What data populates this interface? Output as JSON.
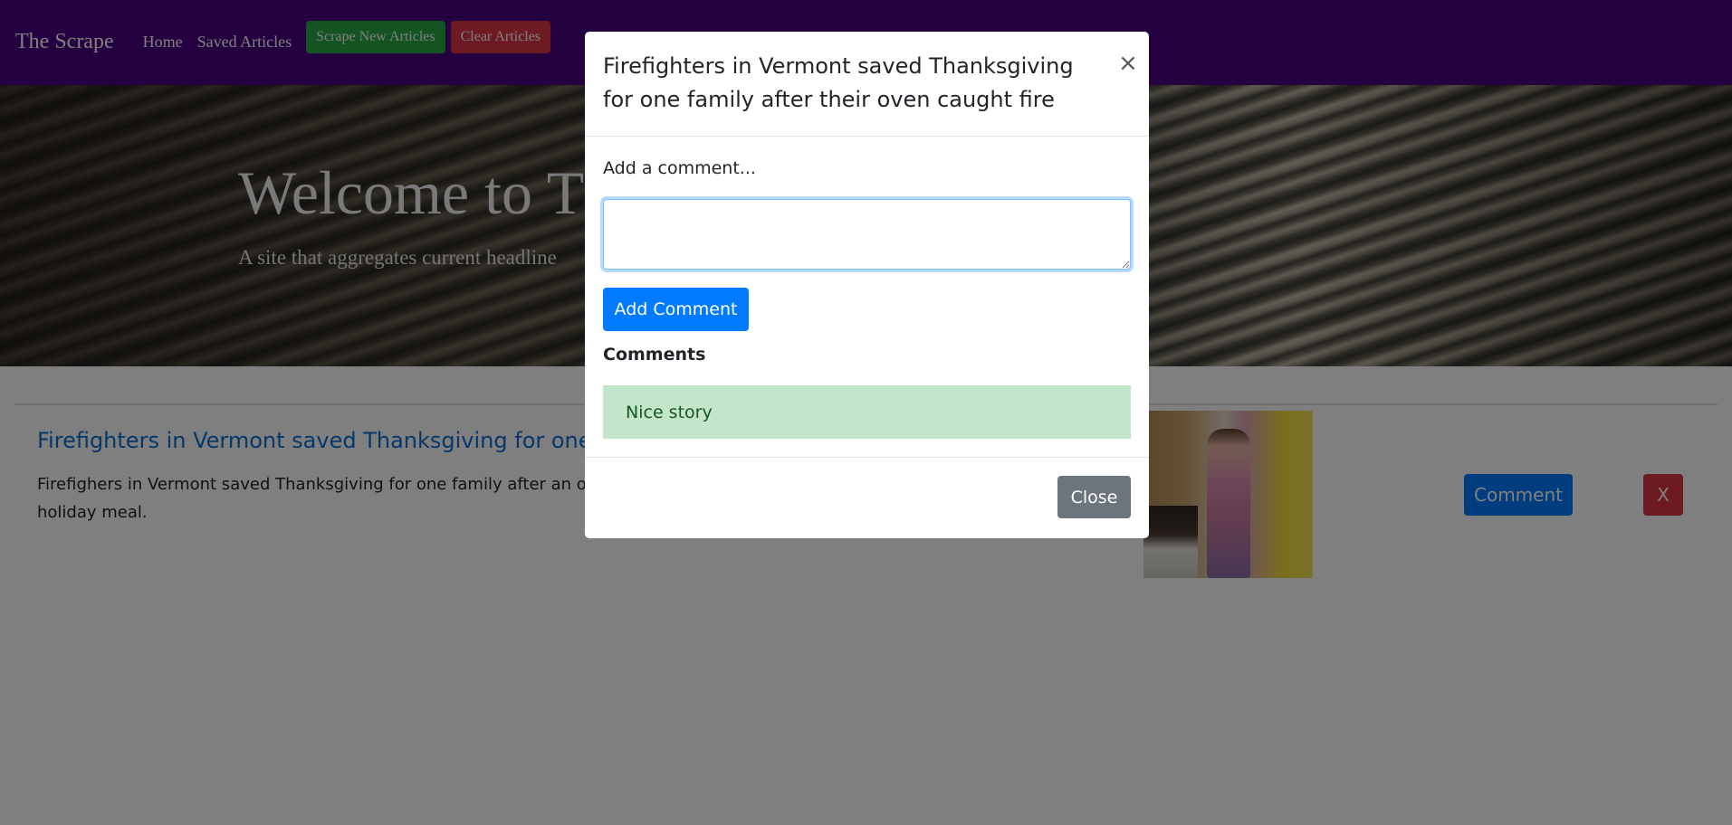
{
  "navbar": {
    "brand": "The Scrape",
    "links": [
      "Home",
      "Saved Articles"
    ],
    "scrape_button": "Scrape New Articles",
    "clear_button": "Clear Articles"
  },
  "hero": {
    "title": "Welcome to T",
    "subtitle": "A site that aggregates current headline"
  },
  "article": {
    "title": "Firefighters in Vermont saved Thanksgiving for one fa",
    "summary": "Firefighers in Vermont saved Thanksgiving for one family after an ove holiday meal.",
    "comment_button": "Comment",
    "delete_button": "X"
  },
  "modal": {
    "title": "Firefighters in Vermont saved Thanksgiving for one family after their oven caught fire",
    "close_glyph": "×",
    "comment_label": "Add a comment...",
    "comment_value": "",
    "add_button": "Add Comment",
    "comments_heading": "Comments",
    "comments": [
      "Nice story"
    ],
    "close_button": "Close"
  },
  "colors": {
    "navbar_bg": "#4b0082",
    "primary": "#007bff",
    "success": "#28a745",
    "danger": "#dc3545",
    "secondary": "#6c757d",
    "comment_bg": "#c3e6cb"
  }
}
